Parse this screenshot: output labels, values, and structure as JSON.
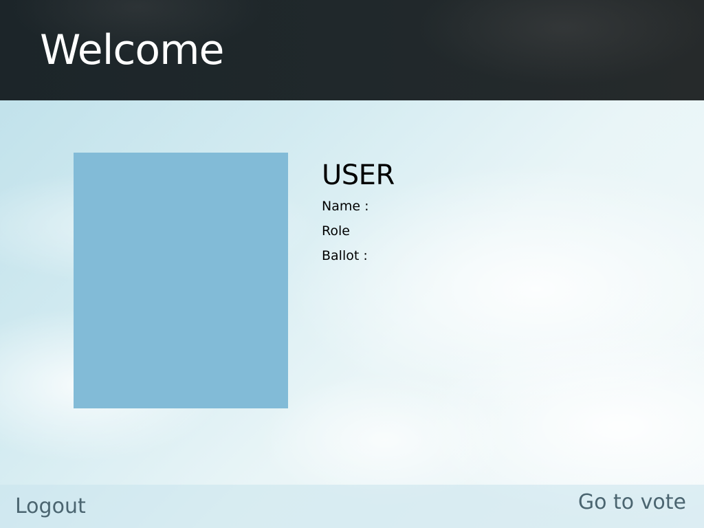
{
  "header": {
    "title": "Welcome"
  },
  "profile": {
    "photo_color": "#82bbd7",
    "heading": "USER",
    "name_label": "Name :",
    "role_label": "Role",
    "ballot_label": "Ballot :"
  },
  "footer": {
    "logout_label": "Logout",
    "vote_label": "Go to vote"
  },
  "colors": {
    "header_bg": "#1f272a",
    "link": "#4b6570",
    "photo": "#82bbd7"
  }
}
